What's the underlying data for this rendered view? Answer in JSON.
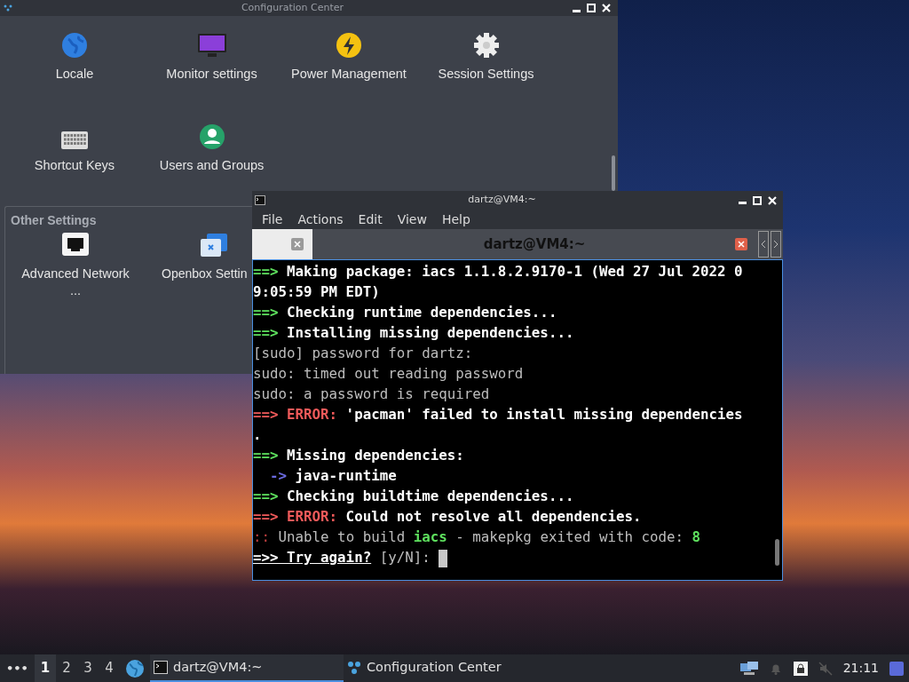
{
  "config_window": {
    "title": "Configuration Center",
    "items": [
      {
        "label": "Locale",
        "kind": "globe"
      },
      {
        "label": "Monitor settings",
        "kind": "monitor"
      },
      {
        "label": "Power Management",
        "kind": "power"
      },
      {
        "label": "Session Settings",
        "kind": "gear"
      },
      {
        "label": "Shortcut Keys",
        "kind": "keyboard"
      },
      {
        "label": "Users and Groups",
        "kind": "user"
      }
    ],
    "section": {
      "title": "Other Settings",
      "items": [
        {
          "label": "Advanced Network ...",
          "kind": "network"
        },
        {
          "label": "Openbox Settin",
          "kind": "windows"
        }
      ]
    }
  },
  "terminal": {
    "title": "dartz@VM4:~",
    "menu": [
      "File",
      "Actions",
      "Edit",
      "View",
      "Help"
    ],
    "tabs": [
      {
        "selected": false
      },
      {
        "label": "dartz@VM4:~",
        "selected": true
      }
    ],
    "lines": [
      [
        {
          "kind": "green",
          "text": "==>"
        },
        {
          "kind": "bold",
          "text": " Making package: iacs 1.1.8.2.9170-1 (Wed 27 Jul 2022 0"
        }
      ],
      [
        {
          "kind": "bold",
          "text": "9:05:59 PM EDT)"
        }
      ],
      [
        {
          "kind": "green",
          "text": "==>"
        },
        {
          "kind": "bold",
          "text": " Checking runtime dependencies..."
        }
      ],
      [
        {
          "kind": "green",
          "text": "==>"
        },
        {
          "kind": "bold",
          "text": " Installing missing dependencies..."
        }
      ],
      [
        {
          "kind": "dim",
          "text": "[sudo] password for dartz:"
        }
      ],
      [
        {
          "kind": "dim",
          "text": "sudo: timed out reading password"
        }
      ],
      [
        {
          "kind": "dim",
          "text": "sudo: a password is required"
        }
      ],
      [
        {
          "kind": "red",
          "text": "==> ERROR:"
        },
        {
          "kind": "bold",
          "text": " 'pacman' failed to install missing dependencies"
        }
      ],
      [
        {
          "kind": "bold",
          "text": "."
        }
      ],
      [
        {
          "kind": "green",
          "text": "==>"
        },
        {
          "kind": "bold",
          "text": " Missing dependencies:"
        }
      ],
      [
        {
          "kind": "blue",
          "text": "  ->"
        },
        {
          "kind": "bold",
          "text": " java-runtime"
        }
      ],
      [
        {
          "kind": "green",
          "text": "==>"
        },
        {
          "kind": "bold",
          "text": " Checking buildtime dependencies..."
        }
      ],
      [
        {
          "kind": "red",
          "text": "==> ERROR:"
        },
        {
          "kind": "bold",
          "text": " Could not resolve all dependencies."
        }
      ],
      [
        {
          "kind": "red-dim",
          "text": "::"
        },
        {
          "kind": "dim",
          "text": " Unable to build "
        },
        {
          "kind": "green",
          "text": "iacs"
        },
        {
          "kind": "dim",
          "text": " - makepkg exited with code: "
        },
        {
          "kind": "green",
          "text": "8"
        }
      ],
      [
        {
          "kind": "underline",
          "text": "=>> Try again?"
        },
        {
          "kind": "dim",
          "text": " [y/N]: "
        },
        {
          "kind": "cursor"
        }
      ]
    ]
  },
  "taskbar": {
    "menu": "•••",
    "workspaces": [
      {
        "label": "1",
        "selected": true
      },
      {
        "label": "2",
        "selected": false
      },
      {
        "label": "3",
        "selected": false
      },
      {
        "label": "4",
        "selected": false
      }
    ],
    "tasks": [
      {
        "label": "dartz@VM4:~",
        "kind": "terminal",
        "selected": true
      },
      {
        "label": "Configuration Center",
        "kind": "config",
        "selected": false
      }
    ],
    "clock": "21:11"
  }
}
